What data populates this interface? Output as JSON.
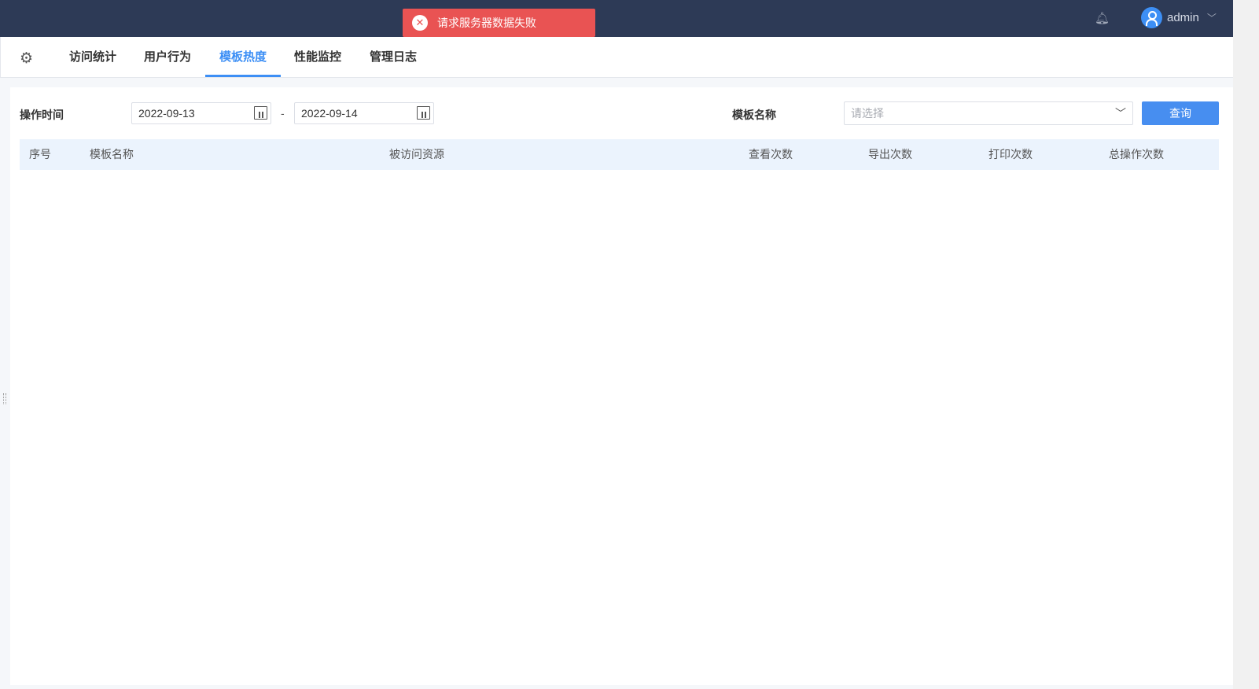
{
  "toast": {
    "message": "请求服务器数据失败",
    "color": "#e95353"
  },
  "header": {
    "user": "admin"
  },
  "tabs": [
    {
      "label": "访问统计"
    },
    {
      "label": "用户行为"
    },
    {
      "label": "模板热度",
      "active": true
    },
    {
      "label": "性能监控"
    },
    {
      "label": "管理日志"
    }
  ],
  "filters": {
    "time_label": "操作时间",
    "start_date": "2022-09-13",
    "separator": "-",
    "end_date": "2022-09-14",
    "template_label": "模板名称",
    "template_placeholder": "请选择",
    "query_button": "查询"
  },
  "table": {
    "columns": [
      "序号",
      "模板名称",
      "被访问资源",
      "查看次数",
      "导出次数",
      "打印次数",
      "总操作次数"
    ],
    "rows": []
  },
  "colors": {
    "accent": "#3d8ff5",
    "topbar": "#2d3a56"
  }
}
